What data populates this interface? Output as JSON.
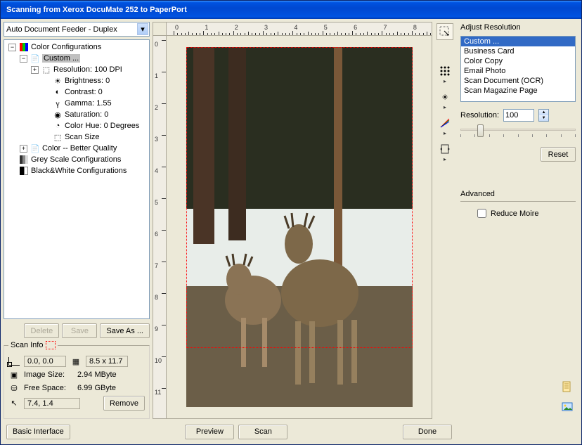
{
  "titlebar": "Scanning from Xerox DocuMate 252 to PaperPort",
  "source_dropdown": "Auto Document Feeder - Duplex",
  "tree": {
    "color_configs": "Color Configurations",
    "custom": "Custom ...",
    "resolution": "Resolution: 100 DPI",
    "brightness": "Brightness: 0",
    "contrast": "Contrast: 0",
    "gamma": "Gamma: 1.55",
    "saturation": "Saturation: 0",
    "hue": "Color Hue: 0 Degrees",
    "scansize": "Scan Size",
    "color_better": "Color -- Better Quality",
    "greyscale": "Grey Scale Configurations",
    "bw": "Black&White Configurations"
  },
  "buttons": {
    "delete": "Delete",
    "save": "Save",
    "saveas": "Save As ...",
    "remove": "Remove",
    "reset": "Reset",
    "basic": "Basic Interface",
    "preview": "Preview",
    "scan": "Scan",
    "done": "Done"
  },
  "scaninfo": {
    "legend": "Scan Info",
    "origin": "0.0, 0.0",
    "size": "8.5 x 11.7",
    "imagesize_label": "Image Size:",
    "imagesize_val": "2.94 MByte",
    "freespace_label": "Free Space:",
    "freespace_val": "6.99 GByte",
    "cursor": "7.4, 1.4"
  },
  "rightpanel": {
    "title": "Adjust Resolution",
    "list": [
      "Custom ...",
      "Business Card",
      "Color Copy",
      "Email Photo",
      "Scan Document (OCR)",
      "Scan Magazine Page"
    ],
    "res_label": "Resolution:",
    "res_value": "100",
    "advanced": "Advanced",
    "reduce_moire": "Reduce Moire"
  },
  "ruler_nums": [
    "0",
    "1",
    "2",
    "3",
    "4",
    "5",
    "6",
    "7",
    "8"
  ],
  "ruler_nums_v": [
    "0",
    "1",
    "2",
    "3",
    "4",
    "5",
    "6",
    "7",
    "8",
    "9",
    "10",
    "11"
  ]
}
